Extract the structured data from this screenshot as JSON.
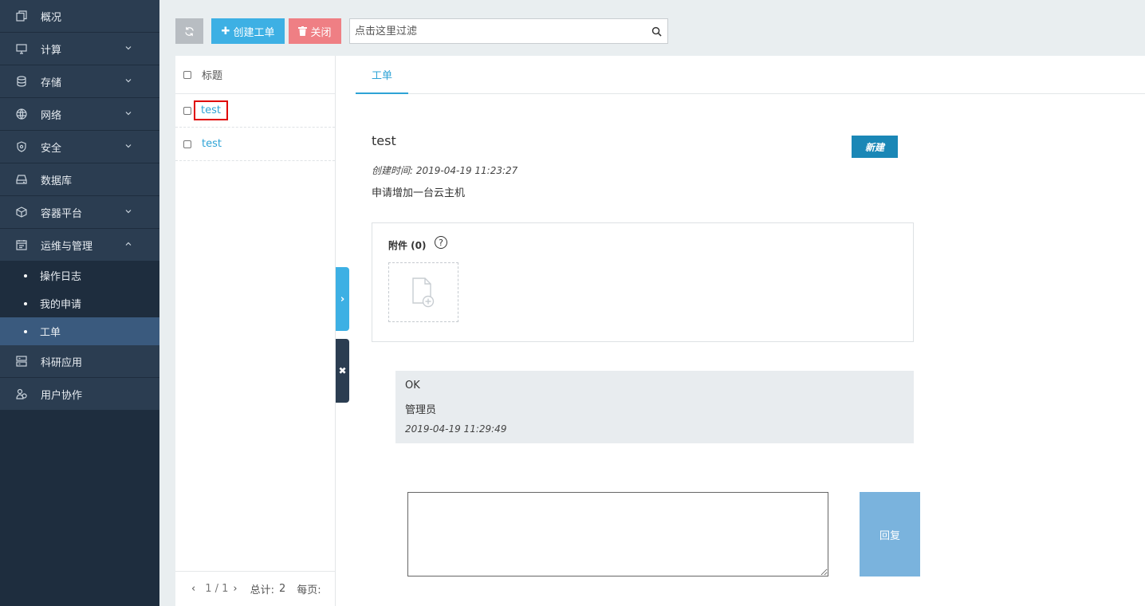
{
  "sidebar": {
    "items": [
      {
        "label": "概况",
        "icon": "overview-icon"
      },
      {
        "label": "计算",
        "icon": "monitor-icon"
      },
      {
        "label": "存储",
        "icon": "database-icon"
      },
      {
        "label": "网络",
        "icon": "globe-icon"
      },
      {
        "label": "安全",
        "icon": "shield-icon"
      },
      {
        "label": "数据库",
        "icon": "drive-icon"
      },
      {
        "label": "容器平台",
        "icon": "container-icon"
      },
      {
        "label": "运维与管理",
        "icon": "calendar-icon"
      },
      {
        "label": "科研应用",
        "icon": "server-icon"
      },
      {
        "label": "用户协作",
        "icon": "users-icon"
      }
    ],
    "sub_items": [
      {
        "label": "操作日志"
      },
      {
        "label": "我的申请"
      },
      {
        "label": "工单"
      }
    ]
  },
  "toolbar": {
    "create_label": "创建工单",
    "close_label": "关闭",
    "search_placeholder": "点击这里过滤"
  },
  "list": {
    "header": "标题",
    "rows": [
      {
        "title": "test"
      },
      {
        "title": "test"
      }
    ],
    "footer": {
      "page": "1 / 1",
      "total_label": "总计:",
      "total_value": "2",
      "per_page_label": "每页:"
    }
  },
  "detail": {
    "tab": "工单",
    "title": "test",
    "new_button": "新建",
    "created": "创建时间: 2019-04-19 11:23:27",
    "description": "申请增加一台云主机",
    "attachments_label": "附件 (0)",
    "help_glyph": "?",
    "comment": {
      "text": "OK",
      "author": "管理员",
      "time": "2019-04-19 11:29:49"
    },
    "reply_button": "回复"
  },
  "colors": {
    "sidebar_bg": "#2b3d51",
    "accent": "#3db0e4",
    "danger": "#ef7f84",
    "active_sub": "#3a5a7e"
  }
}
